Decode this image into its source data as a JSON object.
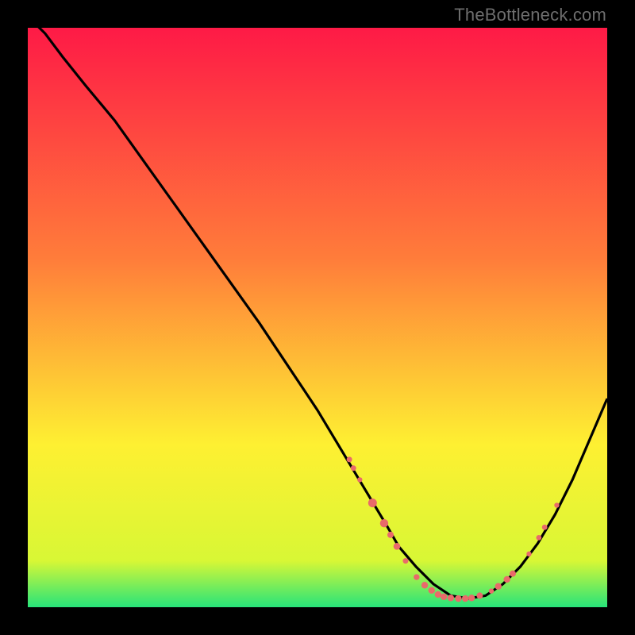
{
  "watermark": "TheBottleneck.com",
  "colors": {
    "gradient_top": "#fe1a46",
    "gradient_mid1": "#ff7d3a",
    "gradient_mid2": "#fef032",
    "gradient_mid3": "#d8f735",
    "gradient_bottom": "#27e47a",
    "line": "#000000",
    "markers": "#e96a6a",
    "background": "#000000"
  },
  "chart_data": {
    "type": "line",
    "title": "",
    "xlabel": "",
    "ylabel": "",
    "xlim": [
      0,
      100
    ],
    "ylim": [
      0,
      100
    ],
    "series": [
      {
        "name": "curve",
        "x": [
          0,
          3,
          6,
          10,
          15,
          20,
          25,
          30,
          35,
          40,
          45,
          50,
          53,
          56,
          59,
          62,
          64,
          67,
          70,
          73,
          76,
          79,
          82,
          85,
          88,
          91,
          94,
          97,
          100
        ],
        "y": [
          102,
          99,
          95,
          90,
          84,
          77,
          70,
          63,
          56,
          49,
          41.5,
          34,
          29,
          24,
          19,
          14,
          10.5,
          7,
          4,
          2,
          1.5,
          2,
          4,
          7,
          11,
          16,
          22,
          29,
          36
        ]
      },
      {
        "name": "markers",
        "points": [
          {
            "x": 55.5,
            "y": 25.5,
            "r": 3.5
          },
          {
            "x": 56.2,
            "y": 24,
            "r": 3.5
          },
          {
            "x": 57.3,
            "y": 22,
            "r": 3.2
          },
          {
            "x": 59.5,
            "y": 18,
            "r": 5.5
          },
          {
            "x": 61.5,
            "y": 14.5,
            "r": 5.2
          },
          {
            "x": 62.6,
            "y": 12.5,
            "r": 4
          },
          {
            "x": 63.7,
            "y": 10.5,
            "r": 4.3
          },
          {
            "x": 65.2,
            "y": 8,
            "r": 3.5
          },
          {
            "x": 67.1,
            "y": 5.2,
            "r": 3.7
          },
          {
            "x": 68.5,
            "y": 3.8,
            "r": 4.2
          },
          {
            "x": 69.7,
            "y": 2.9,
            "r": 4.2
          },
          {
            "x": 70.8,
            "y": 2.2,
            "r": 4.2
          },
          {
            "x": 71.8,
            "y": 1.8,
            "r": 4.2
          },
          {
            "x": 73,
            "y": 1.6,
            "r": 4.2
          },
          {
            "x": 74.3,
            "y": 1.5,
            "r": 4.2
          },
          {
            "x": 75.5,
            "y": 1.5,
            "r": 4.2
          },
          {
            "x": 76.6,
            "y": 1.6,
            "r": 4.2
          },
          {
            "x": 78,
            "y": 2,
            "r": 4.0
          },
          {
            "x": 80,
            "y": 2.8,
            "r": 3.2
          },
          {
            "x": 81.2,
            "y": 3.6,
            "r": 4.2
          },
          {
            "x": 82.7,
            "y": 4.8,
            "r": 4.2
          },
          {
            "x": 83.7,
            "y": 5.8,
            "r": 4.0
          },
          {
            "x": 86.5,
            "y": 9.2,
            "r": 3.2
          },
          {
            "x": 88.2,
            "y": 12,
            "r": 3.4
          },
          {
            "x": 89.2,
            "y": 13.8,
            "r": 3.4
          },
          {
            "x": 91.3,
            "y": 17.6,
            "r": 3.2
          }
        ]
      }
    ]
  }
}
